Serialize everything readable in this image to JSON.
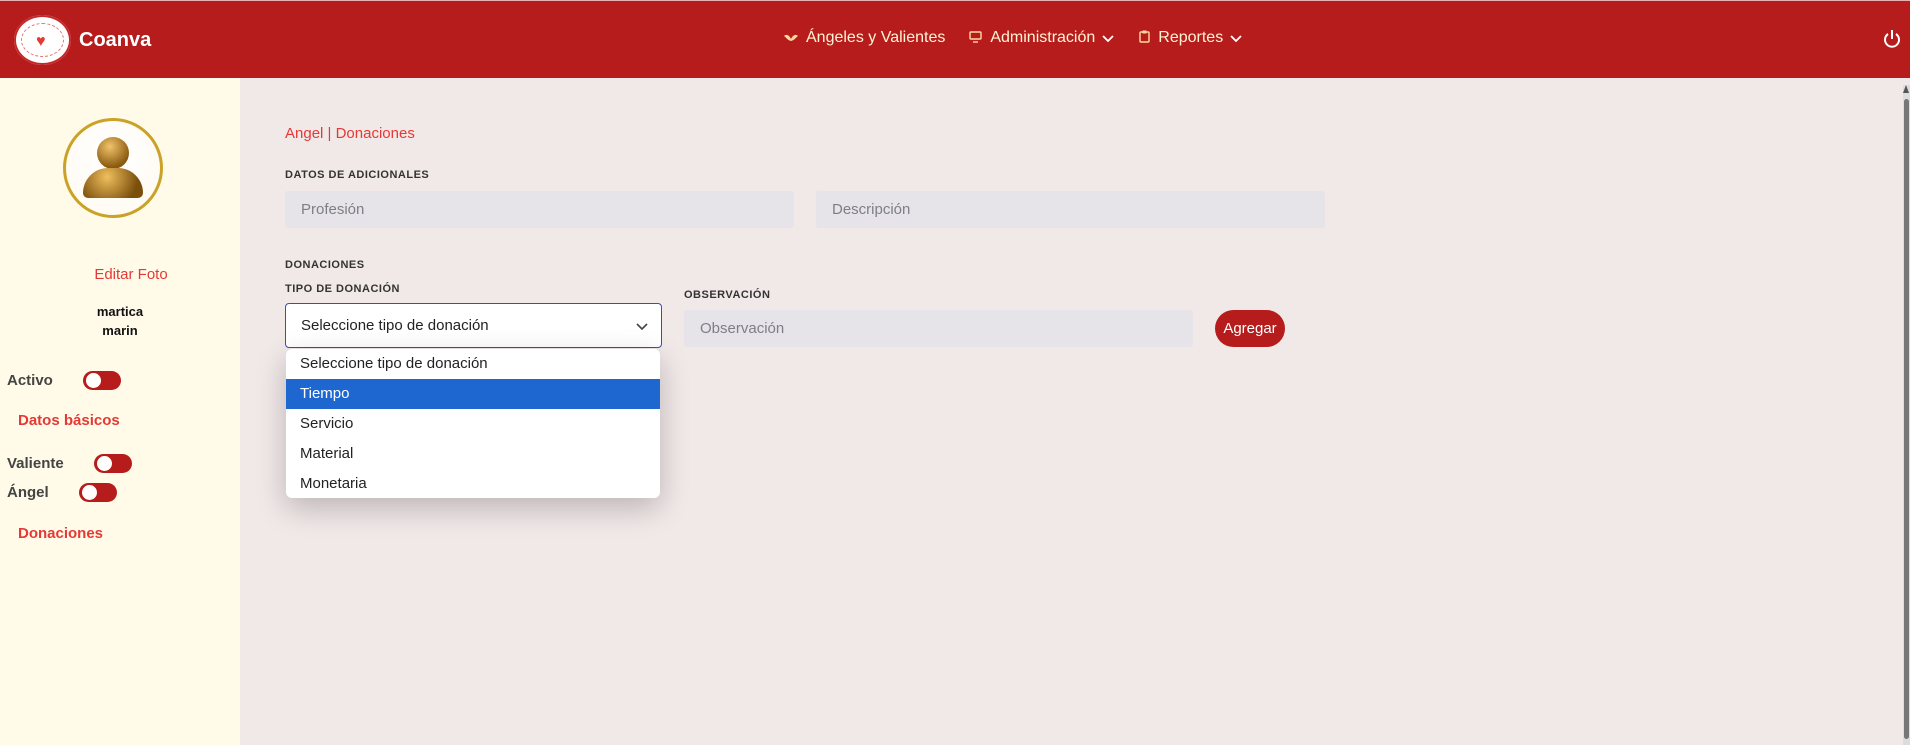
{
  "app": {
    "brand": "Coanva"
  },
  "nav": {
    "items": [
      {
        "label": "Ángeles y Valientes",
        "icon": "angel-wings-icon"
      },
      {
        "label": "Administración",
        "icon": "monitor-icon",
        "has_dropdown": true
      },
      {
        "label": "Reportes",
        "icon": "clipboard-icon",
        "has_dropdown": true
      }
    ],
    "power_icon": "power-icon"
  },
  "sidebar": {
    "edit_photo": "Editar Foto",
    "user_first": "martica",
    "user_last": "marin",
    "activo_label": "Activo",
    "datos_basicos": "Datos básicos",
    "valiente_label": "Valiente",
    "angel_label": "Ángel",
    "donaciones": "Donaciones"
  },
  "main": {
    "breadcrumb": "Angel | Donaciones",
    "adicionales_title": "DATOS DE ADICIONALES",
    "profesion_placeholder": "Profesión",
    "descripcion_placeholder": "Descripción",
    "donaciones_title": "DONACIONES",
    "tipo_label": "TIPO DE DONACIÓN",
    "tipo_value": "Seleccione tipo de donación",
    "tipo_options": [
      "Seleccione tipo de donación",
      "Tiempo",
      "Servicio",
      "Material",
      "Monetaria"
    ],
    "tipo_highlighted": "Tiempo",
    "observacion_label": "OBSERVACIÓN",
    "observacion_placeholder": "Observación",
    "agregar_label": "Agregar"
  },
  "colors": {
    "primary": "#b71c1c",
    "accent_text": "#e53935",
    "sidebar_bg": "#fffbe8",
    "page_bg": "#f1e8e8",
    "highlight": "#1e66d0"
  }
}
